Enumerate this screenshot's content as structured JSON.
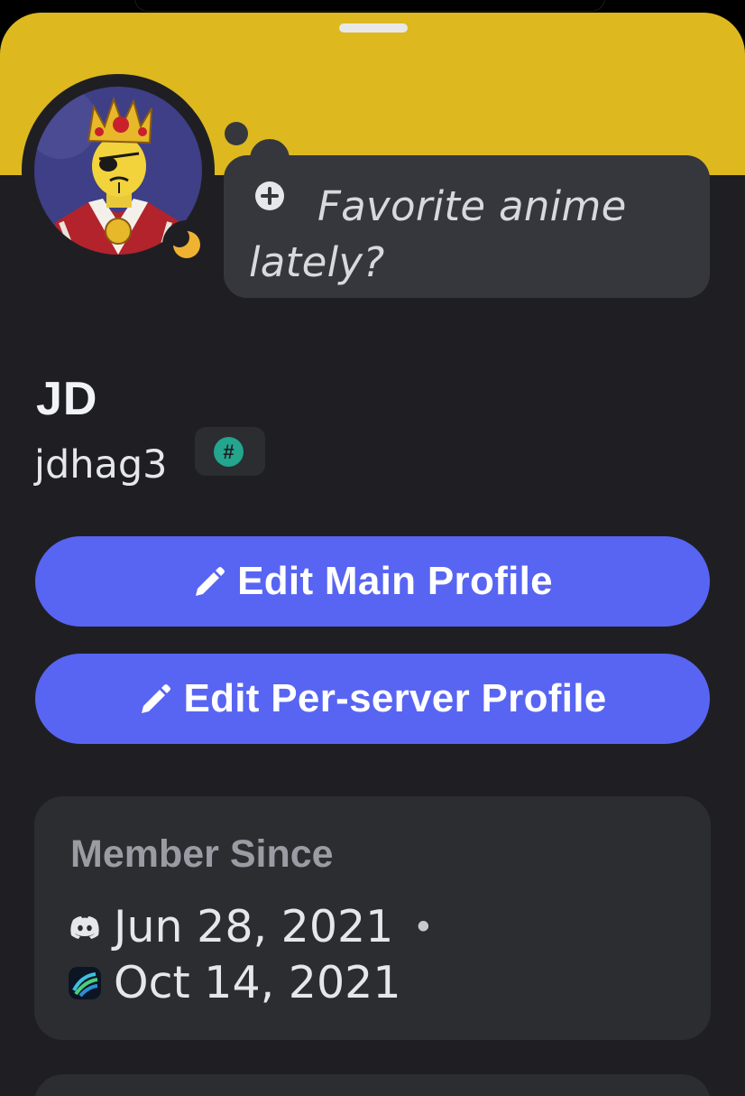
{
  "profile": {
    "display_name": "JD",
    "username": "jdhag3",
    "tag_badge_symbol": "#",
    "banner_color": "#ddb81f",
    "status": "idle",
    "status_color": "#f0b232"
  },
  "status_bubble": {
    "icon": "plus-circle-icon",
    "text": "Favorite anime lately?"
  },
  "actions": {
    "edit_main": "Edit Main Profile",
    "edit_per_server": "Edit Per-server Profile",
    "accent_color": "#5865f2"
  },
  "member_since": {
    "title": "Member Since",
    "discord_date": "Jun 28, 2021",
    "separator": "•",
    "server_date": "Oct 14, 2021"
  }
}
